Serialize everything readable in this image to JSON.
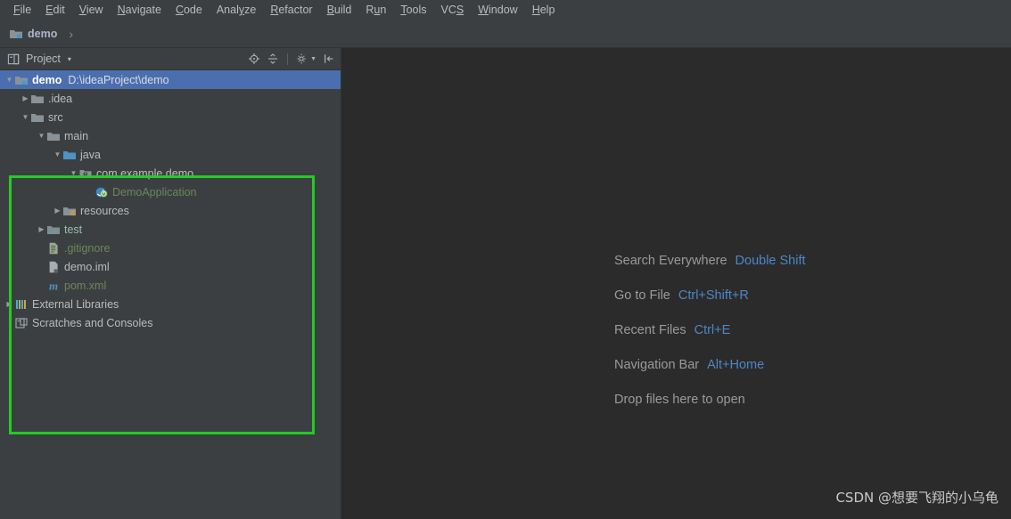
{
  "menubar": {
    "items": [
      {
        "pre": "",
        "mn": "F",
        "post": "ile"
      },
      {
        "pre": "",
        "mn": "E",
        "post": "dit"
      },
      {
        "pre": "",
        "mn": "V",
        "post": "iew"
      },
      {
        "pre": "",
        "mn": "N",
        "post": "avigate"
      },
      {
        "pre": "",
        "mn": "C",
        "post": "ode"
      },
      {
        "pre": "Anal",
        "mn": "y",
        "post": "ze"
      },
      {
        "pre": "",
        "mn": "R",
        "post": "efactor"
      },
      {
        "pre": "",
        "mn": "B",
        "post": "uild"
      },
      {
        "pre": "R",
        "mn": "u",
        "post": "n"
      },
      {
        "pre": "",
        "mn": "T",
        "post": "ools"
      },
      {
        "pre": "VC",
        "mn": "S",
        "post": ""
      },
      {
        "pre": "",
        "mn": "W",
        "post": "indow"
      },
      {
        "pre": "",
        "mn": "H",
        "post": "elp"
      }
    ]
  },
  "navbar": {
    "project_name": "demo",
    "separator": "›"
  },
  "toolwindow": {
    "title": "Project",
    "caret": "▾",
    "actions": [
      {
        "name": "locate-icon"
      },
      {
        "name": "collapse-all-icon"
      },
      {
        "name": "settings-gear-icon"
      },
      {
        "name": "hide-panel-icon"
      }
    ]
  },
  "tree": {
    "rows": [
      {
        "label": "demo",
        "path": "D:\\ideaProject\\demo",
        "indent": 0,
        "arrow": "▼",
        "icon": "module-folder-icon",
        "selected": true,
        "color": "default",
        "name": "tree-row-demo"
      },
      {
        "label": ".idea",
        "path": "",
        "indent": 1,
        "arrow": "▶",
        "icon": "folder-icon",
        "selected": false,
        "color": "default",
        "name": "tree-row-idea"
      },
      {
        "label": "src",
        "path": "",
        "indent": 1,
        "arrow": "▼",
        "icon": "folder-icon",
        "selected": false,
        "color": "default",
        "name": "tree-row-src"
      },
      {
        "label": "main",
        "path": "",
        "indent": 2,
        "arrow": "▼",
        "icon": "folder-icon",
        "selected": false,
        "color": "default",
        "name": "tree-row-main"
      },
      {
        "label": "java",
        "path": "",
        "indent": 3,
        "arrow": "▼",
        "icon": "source-folder-icon",
        "selected": false,
        "color": "default",
        "name": "tree-row-java"
      },
      {
        "label": "com.example.demo",
        "path": "",
        "indent": 4,
        "arrow": "▼",
        "icon": "package-icon",
        "selected": false,
        "color": "default",
        "name": "tree-row-package"
      },
      {
        "label": "DemoApplication",
        "path": "",
        "indent": 5,
        "arrow": "",
        "icon": "spring-boot-class-icon",
        "selected": false,
        "color": "green",
        "name": "tree-row-demoapplication"
      },
      {
        "label": "resources",
        "path": "",
        "indent": 3,
        "arrow": "▶",
        "icon": "resources-folder-icon",
        "selected": false,
        "color": "default",
        "name": "tree-row-resources"
      },
      {
        "label": "test",
        "path": "",
        "indent": 2,
        "arrow": "▶",
        "icon": "test-folder-icon",
        "selected": false,
        "color": "teal",
        "name": "tree-row-test"
      },
      {
        "label": ".gitignore",
        "path": "",
        "indent": 2,
        "arrow": "",
        "icon": "gitignore-file-icon",
        "selected": false,
        "color": "green",
        "name": "tree-row-gitignore"
      },
      {
        "label": "demo.iml",
        "path": "",
        "indent": 2,
        "arrow": "",
        "icon": "iml-file-icon",
        "selected": false,
        "color": "default",
        "name": "tree-row-demo-iml"
      },
      {
        "label": "pom.xml",
        "path": "",
        "indent": 2,
        "arrow": "",
        "icon": "maven-pom-icon",
        "selected": false,
        "color": "green",
        "name": "tree-row-pom-xml"
      },
      {
        "label": "External Libraries",
        "path": "",
        "indent": 0,
        "arrow": "▶",
        "icon": "external-libraries-icon",
        "selected": false,
        "color": "default",
        "name": "tree-row-external-libraries"
      },
      {
        "label": "Scratches and Consoles",
        "path": "",
        "indent": 0,
        "arrow": "",
        "icon": "scratches-icon",
        "selected": false,
        "color": "default",
        "name": "tree-row-scratches"
      }
    ]
  },
  "annotation": {
    "color": "#22cc22"
  },
  "editor": {
    "hints": [
      {
        "action": "Search Everywhere",
        "key": "Double Shift"
      },
      {
        "action": "Go to File",
        "key": "Ctrl+Shift+R"
      },
      {
        "action": "Recent Files",
        "key": "Ctrl+E"
      },
      {
        "action": "Navigation Bar",
        "key": "Alt+Home"
      },
      {
        "action": "Drop files here to open",
        "key": ""
      }
    ],
    "watermark": "CSDN @想要飞翔的小乌龟"
  },
  "colors": {
    "sidebar_bg": "#3c3f41",
    "editor_bg": "#2b2b2b",
    "selection": "#4b6eaf",
    "key_blue": "#4e86c7",
    "annotation_green": "#22cc22"
  }
}
